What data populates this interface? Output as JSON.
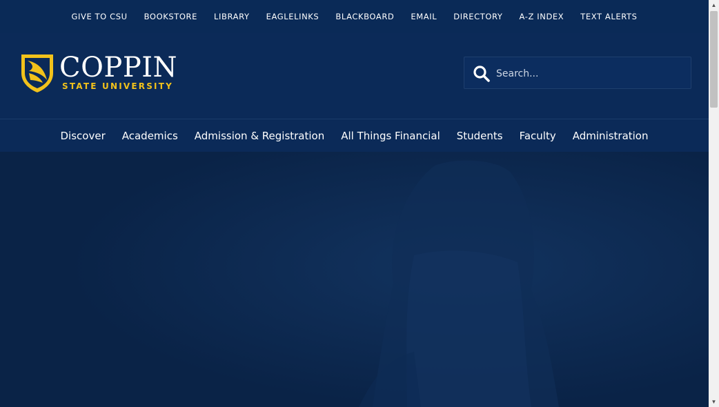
{
  "utility_links": [
    "GIVE TO CSU",
    "BOOKSTORE",
    "LIBRARY",
    "EAGLELINKS",
    "BLACKBOARD",
    "EMAIL",
    "DIRECTORY",
    "A-Z INDEX",
    "TEXT ALERTS"
  ],
  "logo": {
    "name": "COPPIN",
    "subtitle": "STATE UNIVERSITY",
    "shield_color": "#f2c21b"
  },
  "search": {
    "placeholder": "Search...",
    "icon": "search-icon"
  },
  "main_nav": [
    "Discover",
    "Academics",
    "Admission & Registration",
    "All Things Financial",
    "Students",
    "Faculty",
    "Administration"
  ],
  "colors": {
    "header_bg": "#0b2a58",
    "accent_gold": "#f2c21b",
    "hero_bg": "#0a2347"
  },
  "scrollbar": {
    "up_icon": "arrow-up-icon",
    "down_icon": "arrow-down-icon"
  }
}
